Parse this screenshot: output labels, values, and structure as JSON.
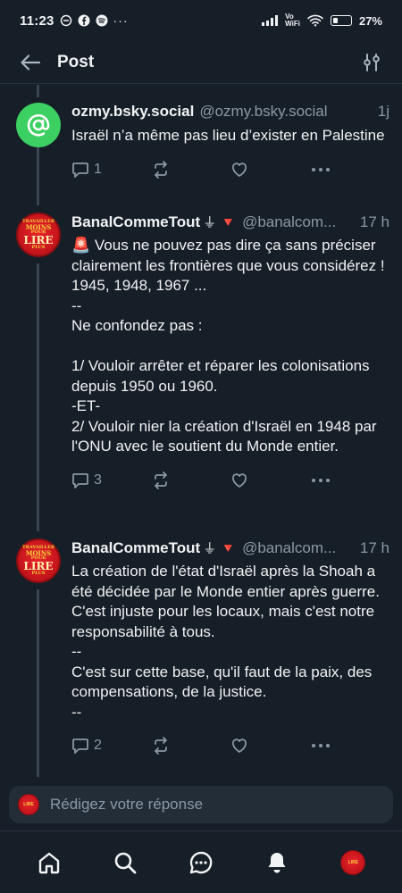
{
  "statusbar": {
    "time": "11:23",
    "net_label_1": "Vo",
    "net_label_2": "WiFi",
    "battery": "27%"
  },
  "header": {
    "title": "Post"
  },
  "posts": [
    {
      "display_name": "ozmy.bsky.social",
      "handle": "@ozmy.bsky.social",
      "time": "1j",
      "body": "Israël n’a même pas lieu d’exister en Palestine",
      "replies": "1",
      "reposts": "",
      "likes": "",
      "avatar_icon": "at-sign-icon"
    },
    {
      "display_name": "BanalCommeTout",
      "badges": "⏚ 🔻",
      "handle": "@banalcom...",
      "time": "17 h",
      "body": "🚨 Vous ne pouvez pas dire ça sans préciser clairement les frontières que vous considérez !\n1945, 1948, 1967 ...\n--\nNe confondez pas :\n\n1/ Vouloir arrêter et réparer les colonisations depuis 1950 ou 1960.\n-ET-\n2/ Vouloir nier la création d'Israël en 1948 par l'ONU avec le soutient du Monde entier.",
      "replies": "3",
      "reposts": "",
      "likes": "",
      "avatar_text": [
        "TRAVAILLER",
        "MOINS",
        "POUR",
        "LIRE",
        "PLUS"
      ]
    },
    {
      "display_name": "BanalCommeTout",
      "badges": "⏚ 🔻",
      "handle": "@banalcom...",
      "time": "17 h",
      "body": "La création de l'état d'Israël après la Shoah a été décidée par le Monde entier après guerre. C'est injuste pour les locaux, mais c'est notre responsabilité à tous.\n--\nC'est sur cette base, qu'il faut de la paix, des compensations, de la justice.\n--",
      "replies": "2",
      "reposts": "",
      "likes": "",
      "avatar_text": [
        "TRAVAILLER",
        "MOINS",
        "POUR",
        "LIRE",
        "PLUS"
      ]
    }
  ],
  "reply_box": {
    "placeholder": "Rédigez votre réponse"
  },
  "colors": {
    "background": "#161e27",
    "muted": "#8b98a5",
    "avatar_green": "#3ccf62",
    "avatar_red": "#c9161d"
  }
}
